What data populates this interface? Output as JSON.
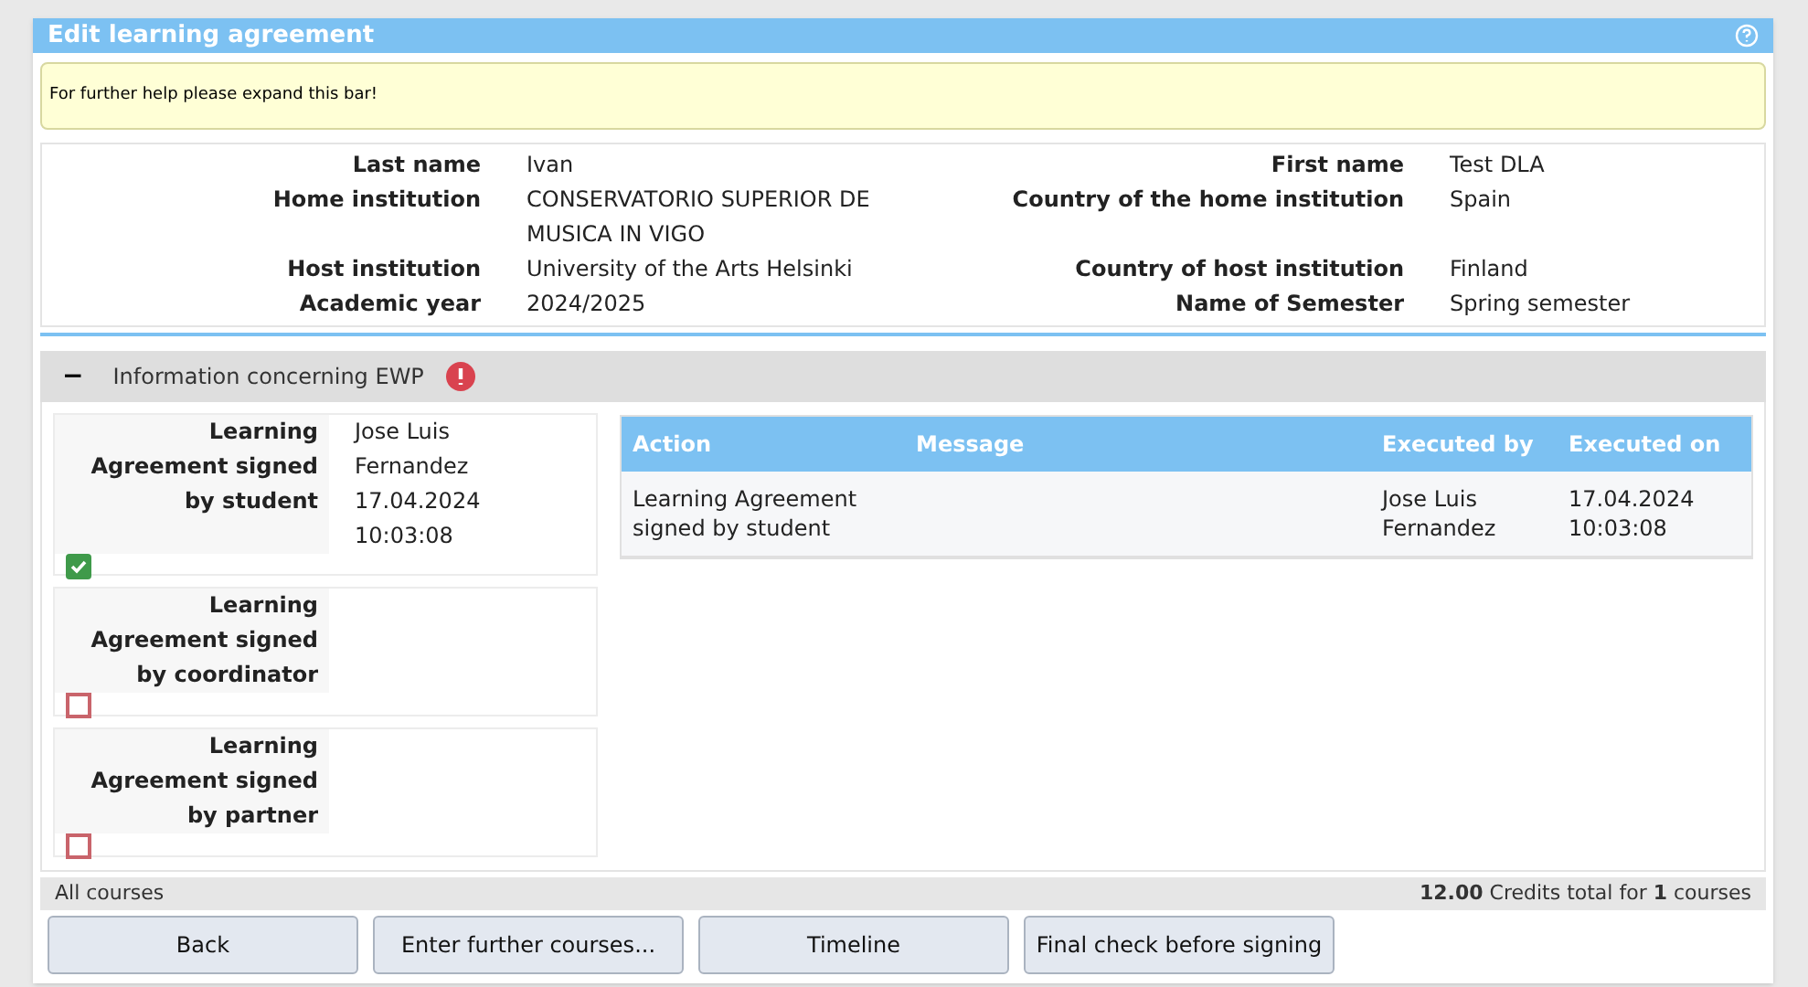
{
  "window": {
    "title": "Edit learning agreement"
  },
  "help_bar": {
    "text": "For further help please expand this bar!"
  },
  "personal_info": [
    {
      "label": "Last name",
      "value": "Ivan"
    },
    {
      "label": "First name",
      "value": "Test DLA"
    },
    {
      "label": "Home institution",
      "value": "CONSERVATORIO SUPERIOR DE MUSICA IN VIGO"
    },
    {
      "label": "Country of the home institution",
      "value": "Spain"
    },
    {
      "label": "Host institution",
      "value": "University of the Arts Helsinki"
    },
    {
      "label": "Country of host institution",
      "value": "Finland"
    },
    {
      "label": "Academic year",
      "value": "2024/2025"
    },
    {
      "label": "Name of Semester",
      "value": "Spring semester"
    }
  ],
  "ewp_section": {
    "toggle": "−",
    "title": "Information concerning EWP",
    "warning": true
  },
  "signatures": [
    {
      "label": "Learning Agreement signed by student",
      "signer": "Jose Luis Fernandez",
      "date": "17.04.2024 10:03:08",
      "checked": true
    },
    {
      "label": "Learning Agreement signed by coordinator",
      "checked": false
    },
    {
      "label": "Learning Agreement signed by partner",
      "checked": false
    }
  ],
  "history_table": {
    "columns": [
      "Action",
      "Message",
      "Executed by",
      "Executed on"
    ],
    "rows": [
      [
        "Learning Agreement signed by student",
        "",
        "Jose Luis Fernandez",
        "17.04.2024 10:03:08"
      ]
    ]
  },
  "courses_bar": {
    "label": "All courses",
    "total": "**12.00** Credits total for **1** courses"
  },
  "buttons": [
    "Back",
    "Enter further courses...",
    "Timeline",
    "Final check before signing"
  ]
}
